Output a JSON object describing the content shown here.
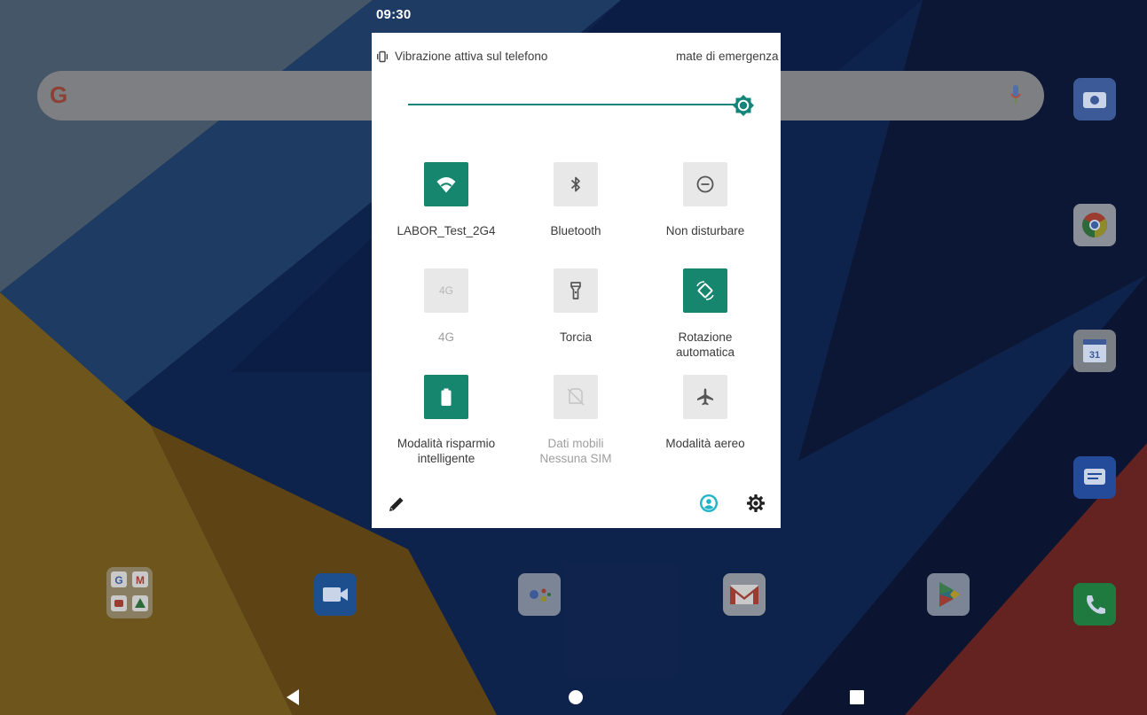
{
  "status_bar": {
    "time": "09:30"
  },
  "quick_settings": {
    "vibration_text": "Vibrazione attiva sul telefono",
    "emergency_text": "mate di emergenza",
    "brightness_fraction": 1.0,
    "tiles": [
      {
        "id": "wifi",
        "label": "LABOR_Test_2G4",
        "sublabel": "",
        "state": "on",
        "icon": "wifi-icon"
      },
      {
        "id": "bluetooth",
        "label": "Bluetooth",
        "sublabel": "",
        "state": "off",
        "icon": "bluetooth-icon"
      },
      {
        "id": "dnd",
        "label": "Non disturbare",
        "sublabel": "",
        "state": "off",
        "icon": "do-not-disturb-icon"
      },
      {
        "id": "lte",
        "label": "4G",
        "sublabel": "",
        "state": "unavailable",
        "icon": "lte-icon",
        "icon_text": "4G"
      },
      {
        "id": "torch",
        "label": "Torcia",
        "sublabel": "",
        "state": "off",
        "icon": "flashlight-icon"
      },
      {
        "id": "rotation",
        "label": "Rotazione",
        "sublabel": "automatica",
        "state": "on",
        "icon": "auto-rotate-icon"
      },
      {
        "id": "battery",
        "label": "Modalità risparmio",
        "sublabel": "intelligente",
        "state": "on",
        "icon": "battery-icon"
      },
      {
        "id": "data",
        "label": "Dati mobili",
        "sublabel": "Nessuna SIM",
        "state": "unavailable",
        "icon": "no-sim-icon"
      },
      {
        "id": "airplane",
        "label": "Modalità aereo",
        "sublabel": "",
        "state": "off",
        "icon": "airplane-icon"
      }
    ],
    "colors": {
      "accent": "#17866f",
      "tile_off": "#e8e8e8",
      "user_icon": "#21b3c7"
    }
  },
  "home_screen": {
    "search_bar_logo": "G",
    "apps": [
      "google-folder-icon",
      "meet-icon",
      "assistant-icon",
      "gmail-icon",
      "play-store-icon",
      "phone-icon",
      "camera-icon",
      "chrome-icon",
      "calendar-icon",
      "messages-icon"
    ],
    "calendar_day": "31"
  }
}
